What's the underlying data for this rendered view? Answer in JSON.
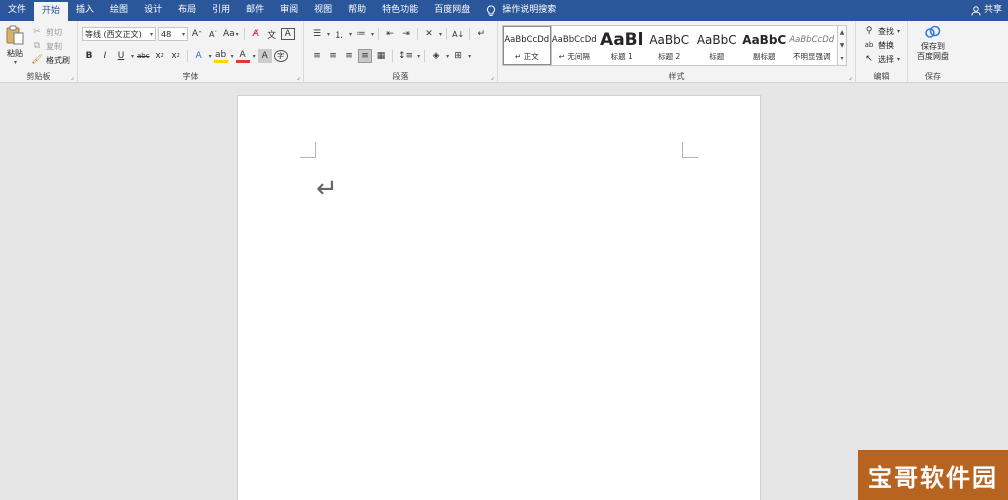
{
  "tabs": [
    "文件",
    "开始",
    "插入",
    "绘图",
    "设计",
    "布局",
    "引用",
    "邮件",
    "审阅",
    "视图",
    "帮助",
    "特色功能",
    "百度网盘"
  ],
  "tell_me": "操作说明搜索",
  "share": "共享",
  "clipboard": {
    "paste": "粘贴",
    "cut": "剪切",
    "copy": "复制",
    "format_painter": "格式刷",
    "label": "剪贴板"
  },
  "font": {
    "name": "等线 (西文正文)",
    "size": "48",
    "label": "字体"
  },
  "paragraph": {
    "label": "段落"
  },
  "styles": {
    "label": "样式",
    "items": [
      {
        "sample": "AaBbCcDd",
        "name": "正文"
      },
      {
        "sample": "AaBbCcDd",
        "name": "无间隔"
      },
      {
        "sample": "AaBl",
        "name": "标题 1"
      },
      {
        "sample": "AaBbC",
        "name": "标题 2"
      },
      {
        "sample": "AaBbC",
        "name": "标题"
      },
      {
        "sample": "AaBbC",
        "name": "副标题"
      },
      {
        "sample": "AaBbCcDd",
        "name": "不明显强调"
      }
    ]
  },
  "editing": {
    "find": "查找",
    "replace": "替换",
    "select": "选择",
    "label": "编辑"
  },
  "save": {
    "button": "保存到\n百度网盘",
    "button_line1": "保存到",
    "button_line2": "百度网盘",
    "label": "保存"
  },
  "watermark": "宝哥软件园",
  "colors": {
    "tabbar": "#2b579a",
    "ribbon": "#f3f3f3",
    "canvas": "#e6e6e6",
    "highlight": "#ffd400",
    "font_color": "#e03a2f"
  }
}
